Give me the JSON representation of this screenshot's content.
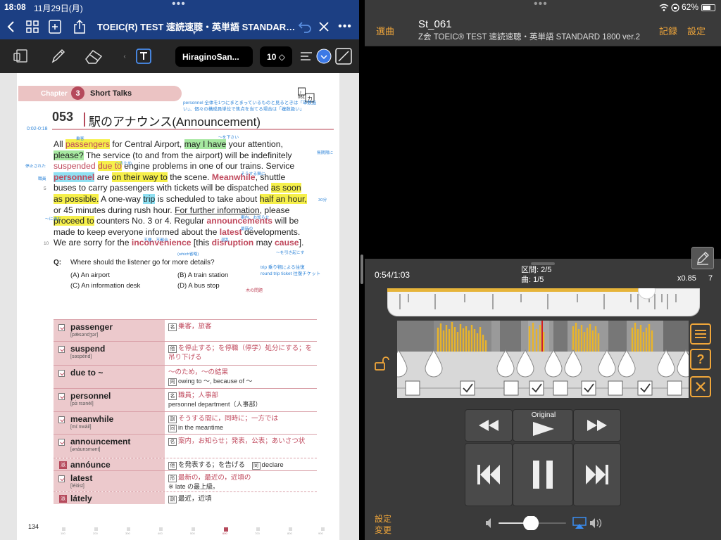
{
  "status": {
    "time": "18:08",
    "date": "11月29日(月)",
    "battery": "62%"
  },
  "left_app": {
    "doc_title": "TOEIC(R) TEST 速読速聴・英単語 STANDARD...",
    "font_name": "HiraginoSan...",
    "font_size": "10 ◇",
    "accent": "#1c3f83"
  },
  "page": {
    "chapter_label": "Chapter",
    "chapter_number": "3",
    "chapter_title": "Short Talks",
    "chapter_icon_text": "061",
    "note_top": "personnel 全体を1つにまとまっているものと見るときは「単数扱い」、個々の構成員単位で焦点を当てる場合は「複数扱い」",
    "unit_number": "053",
    "unit_title": "駅のアナウンス(Announcement)",
    "timecode": "0:02-0:18",
    "lines": [
      [
        "All ",
        "passengers",
        " for Central Airport, ",
        "may I have",
        " your attention,"
      ],
      [
        "please?",
        " The service (to and from the airport) will be indefinitely"
      ],
      [
        "suspended",
        " ",
        "due to",
        " engine problems in one of our trains. Service"
      ],
      [
        "personnel",
        " are ",
        "on their way to",
        " the scene. ",
        "Meanwhile",
        ", shuttle"
      ],
      [
        "buses to carry passengers with tickets will be dispatched ",
        "as soon"
      ],
      [
        "as possible.",
        " A one-way ",
        "trip",
        " is scheduled to take about ",
        "half an hour,"
      ],
      [
        "or 45 minutes during rush hour.  ",
        "For further information",
        ", please"
      ],
      [
        "proceed to",
        " counters No. 3 or 4.  Regular ",
        "announcements",
        " will be"
      ],
      [
        "made to keep everyone informed about the ",
        "latest",
        " developments."
      ],
      [
        "We are sorry for the ",
        "inconvenience",
        " [this ",
        "disruption",
        " may ",
        "cause",
        "]."
      ]
    ],
    "line_numbers": [
      "5",
      "10"
    ],
    "annotations": [
      "乗客",
      "〜を下さい",
      "停止された",
      "職員",
      "30分",
      "無期限に",
      "〜に進む",
      "〜のため",
      "そうする間に",
      "案内、お知らせ",
      "最新の",
      "不便、不都合",
      "混乱",
      "〜を引き起こす",
      "(which省略)"
    ],
    "question": {
      "label": "Q:",
      "text": "Where should the listener go for more details?",
      "options": [
        "(A)  An airport",
        "(B)  A train station",
        "(C)  An information desk",
        "(D)  A bus stop"
      ],
      "note": "trip 乗り物による往復\nround trip ticket 往復チケット",
      "note2": "木の問題"
    },
    "vocab": [
      {
        "word": "passenger",
        "pron": "[pǽsəndʒər]",
        "pos": "名",
        "def": "乗客，旅客"
      },
      {
        "word": "suspend",
        "pron": "[səspénd]",
        "pos": "他",
        "def": "を停止する；を停職（停学）処分にする；を吊り下げる"
      },
      {
        "word": "due to ~",
        "pron": "",
        "pos": "",
        "def": "〜のため，〜の結果",
        "sub_tag": "同",
        "sub": "owing to 〜, because of 〜"
      },
      {
        "word": "personnel",
        "pron": "[pə̀ːrsənél]",
        "pos": "名",
        "def": "職員；人事部",
        "sub": "personnel department（人事部）"
      },
      {
        "word": "meanwhile",
        "pron": "[míːnwàil]",
        "pos": "副",
        "def": "そうする間に，同時に；一方では",
        "sub_tag": "同",
        "sub": "in the meantime"
      },
      {
        "word": "announcement",
        "pron": "[ənáunsmənt]",
        "pos": "名",
        "def": "案内，お知らせ；発表，公表；あいさつ状"
      },
      {
        "word": "annóunce",
        "pron": "",
        "tag": "派",
        "pos": "他",
        "def": "を発表する；を告げる",
        "sub_tag": "同",
        "sub": "declare"
      },
      {
        "word": "latest",
        "pron": "[léitist]",
        "pos": "形",
        "def": "最新の，最近の，近頃の",
        "sub": "※ late の最上級。"
      },
      {
        "word": "látely",
        "pron": "",
        "tag": "派",
        "pos": "副",
        "def": "最近，近頃"
      }
    ],
    "page_number": "134",
    "scrub_labels": [
      "100",
      "200",
      "300",
      "400",
      "500",
      "600",
      "700",
      "800",
      "900"
    ]
  },
  "right_app": {
    "btn_songs": "選曲",
    "track_name": "St_061",
    "track_subtitle": "Z会 TOEIC® TEST 速読速聴・英単語 STANDARD 1800 ver.2",
    "btn_record": "記録",
    "btn_settings": "設定",
    "time": "0:54/1:03",
    "section": "区間: 2/5",
    "song": "曲: 1/5",
    "speed": "x0.85",
    "speed_num": "7",
    "seek_progress": 0.83,
    "original_label": "Original",
    "config_label_1": "設定",
    "config_label_2": "変更",
    "volume": 0.48,
    "accent": "#f0a63a",
    "checkboxes": [
      false,
      true,
      false,
      true,
      false,
      true,
      false,
      true,
      false
    ]
  }
}
